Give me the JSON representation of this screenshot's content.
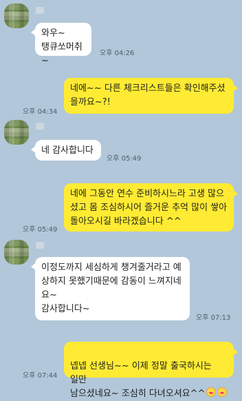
{
  "messages": [
    {
      "dir": "in",
      "text": "와우~\n탱큐쏘머취~",
      "time": "오후 04:26"
    },
    {
      "dir": "out",
      "text": "네에~~ 다른 체크리스트들은 확인해주셨\n을까요~?!",
      "time": "오후 04:34"
    },
    {
      "dir": "in",
      "text": "네 감사합니다",
      "time": "오후 05:49"
    },
    {
      "dir": "out",
      "text": "네에 그동안 연수 준비하시느라 고생 많으\n셨고 몸 조심하시어 즐거운 추억 많이 쌓아\n돌아오시길 바라겠습니다 ^^",
      "time": "오후 05:49"
    },
    {
      "dir": "in",
      "text": "이정도까지 세심하게 챙겨줄거라고 예\n상하지 못했기때문에 감동이 느껴지네\n요~\n감사합니다~",
      "time": "오후 07:13"
    },
    {
      "dir": "out",
      "text": "넵넵 선생님~~ 이제 정말 출국하시는 일만\n남으셨네요~ 조심히 다녀오셔요^^",
      "time": "오후 07:44",
      "emoji": [
        "grinning-face-icon",
        "grinning-face-icon"
      ]
    }
  ]
}
